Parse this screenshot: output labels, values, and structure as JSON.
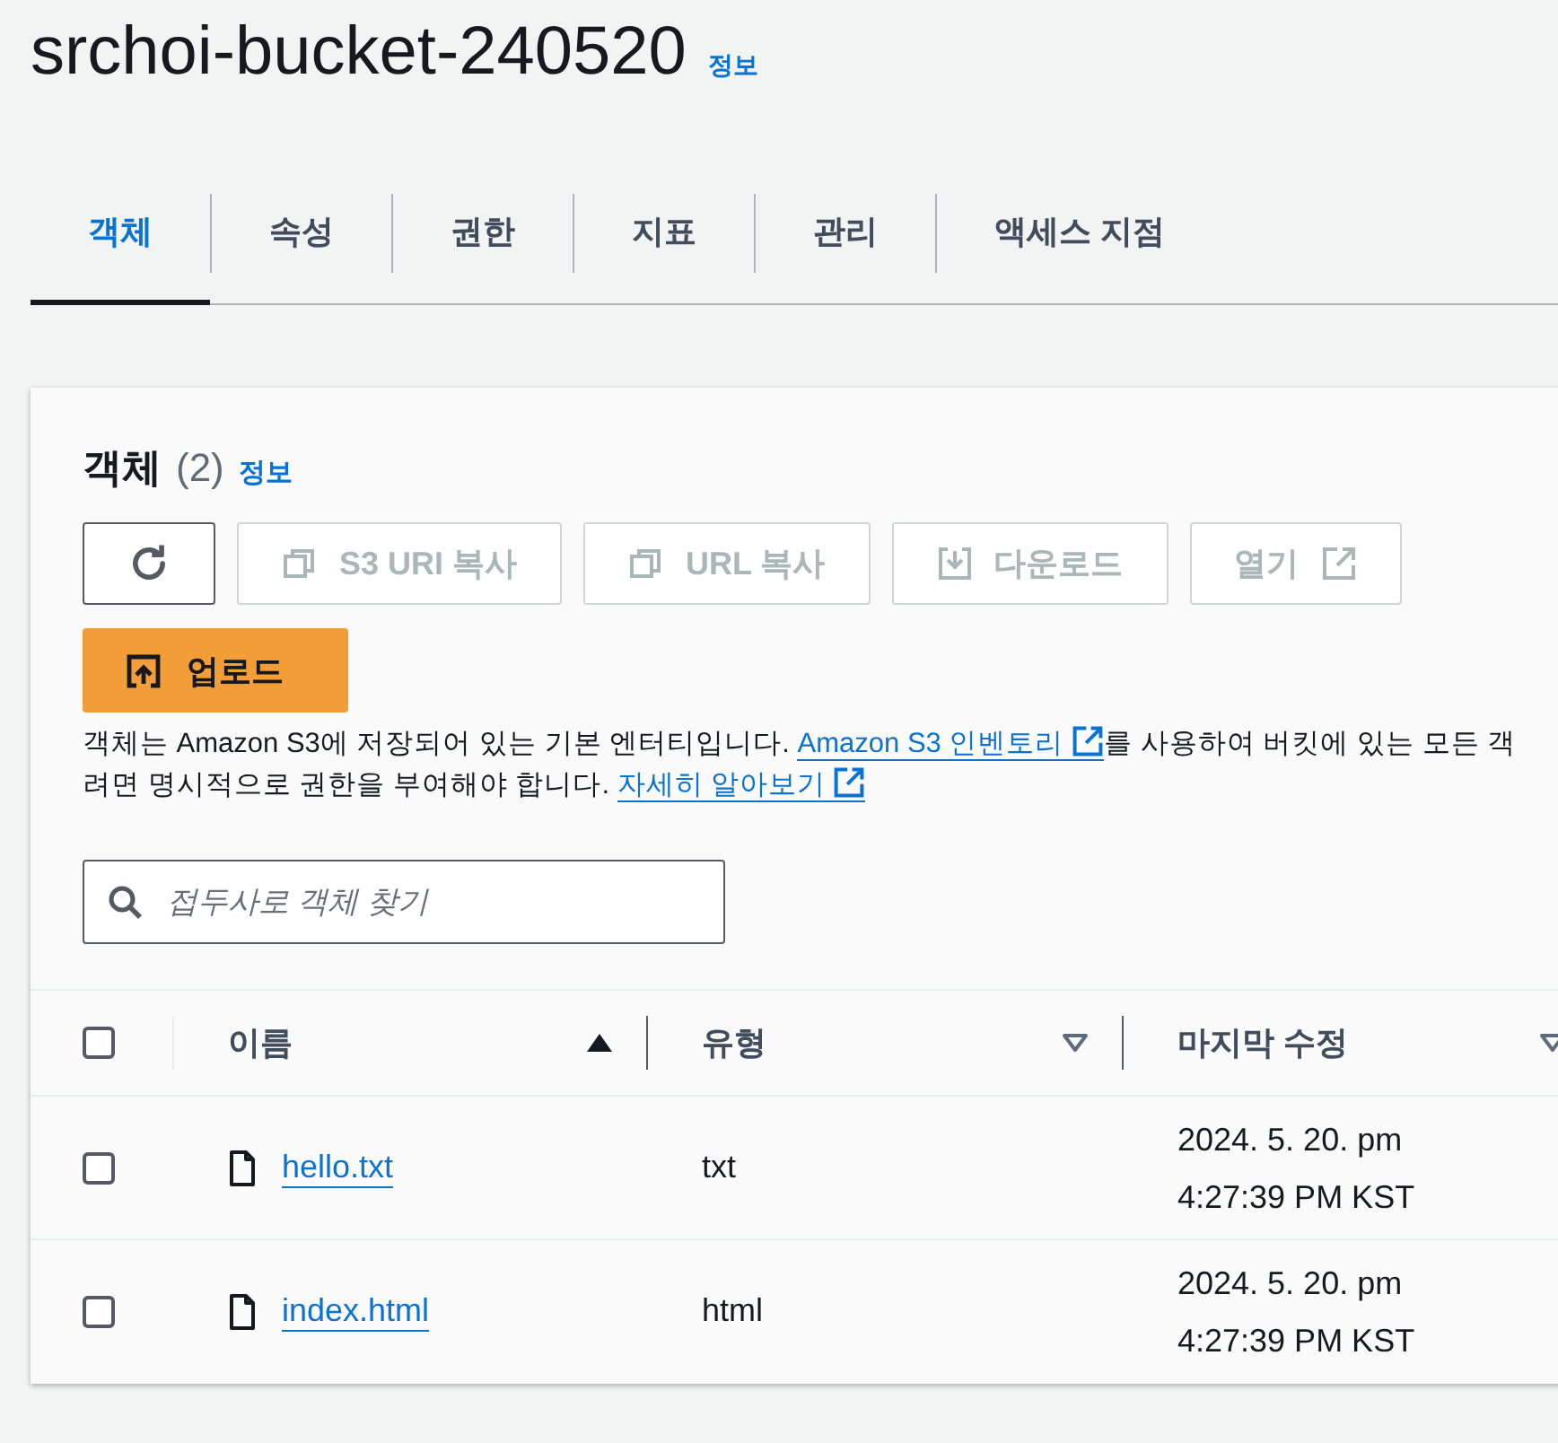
{
  "bucket": {
    "title": "srchoi-bucket-240520",
    "info_link": "정보"
  },
  "tabs": [
    {
      "label": "객체",
      "selected": true
    },
    {
      "label": "속성",
      "selected": false
    },
    {
      "label": "권한",
      "selected": false
    },
    {
      "label": "지표",
      "selected": false
    },
    {
      "label": "관리",
      "selected": false
    },
    {
      "label": "액세스 지점",
      "selected": false
    }
  ],
  "objects_panel": {
    "title": "객체",
    "count": "(2)",
    "info_link": "정보",
    "toolbar": [
      {
        "kind": "refresh",
        "disabled": false
      },
      {
        "kind": "copy",
        "label": "S3 URI 복사",
        "disabled": true
      },
      {
        "kind": "copy",
        "label": "URL 복사",
        "disabled": true
      },
      {
        "kind": "download",
        "label": "다운로드",
        "disabled": true
      },
      {
        "kind": "open",
        "label": "열기",
        "disabled": true
      }
    ],
    "upload_button": "업로드",
    "description": [
      [
        {
          "kind": "text",
          "text": "객체는 Amazon S3에 저장되어 있는 기본 엔터티입니다. "
        },
        {
          "kind": "link",
          "text": "Amazon S3 인벤토리"
        },
        {
          "kind": "text",
          "text": "를 사용하여 버킷에 있는 모든 객"
        }
      ],
      [
        {
          "kind": "text",
          "text": "려면 명시적으로 권한을 부여해야 합니다. "
        },
        {
          "kind": "link",
          "text": "자세히 알아보기"
        }
      ]
    ],
    "search": {
      "placeholder": "접두사로 객체 찾기"
    },
    "table": {
      "select_all_checked": false,
      "columns": [
        {
          "label": "이름",
          "sorted": true
        },
        {
          "label": "유형",
          "sorted": false
        },
        {
          "label": "마지막 수정",
          "sorted": false
        }
      ],
      "rows": [
        {
          "checked": false,
          "name": "hello.txt",
          "type": "txt",
          "modified": [
            "2024. 5. 20. pm",
            "4:27:39 PM KST"
          ]
        },
        {
          "checked": false,
          "name": "index.html",
          "type": "html",
          "modified": [
            "2024. 5. 20. pm",
            "4:27:39 PM KST"
          ]
        }
      ]
    }
  }
}
